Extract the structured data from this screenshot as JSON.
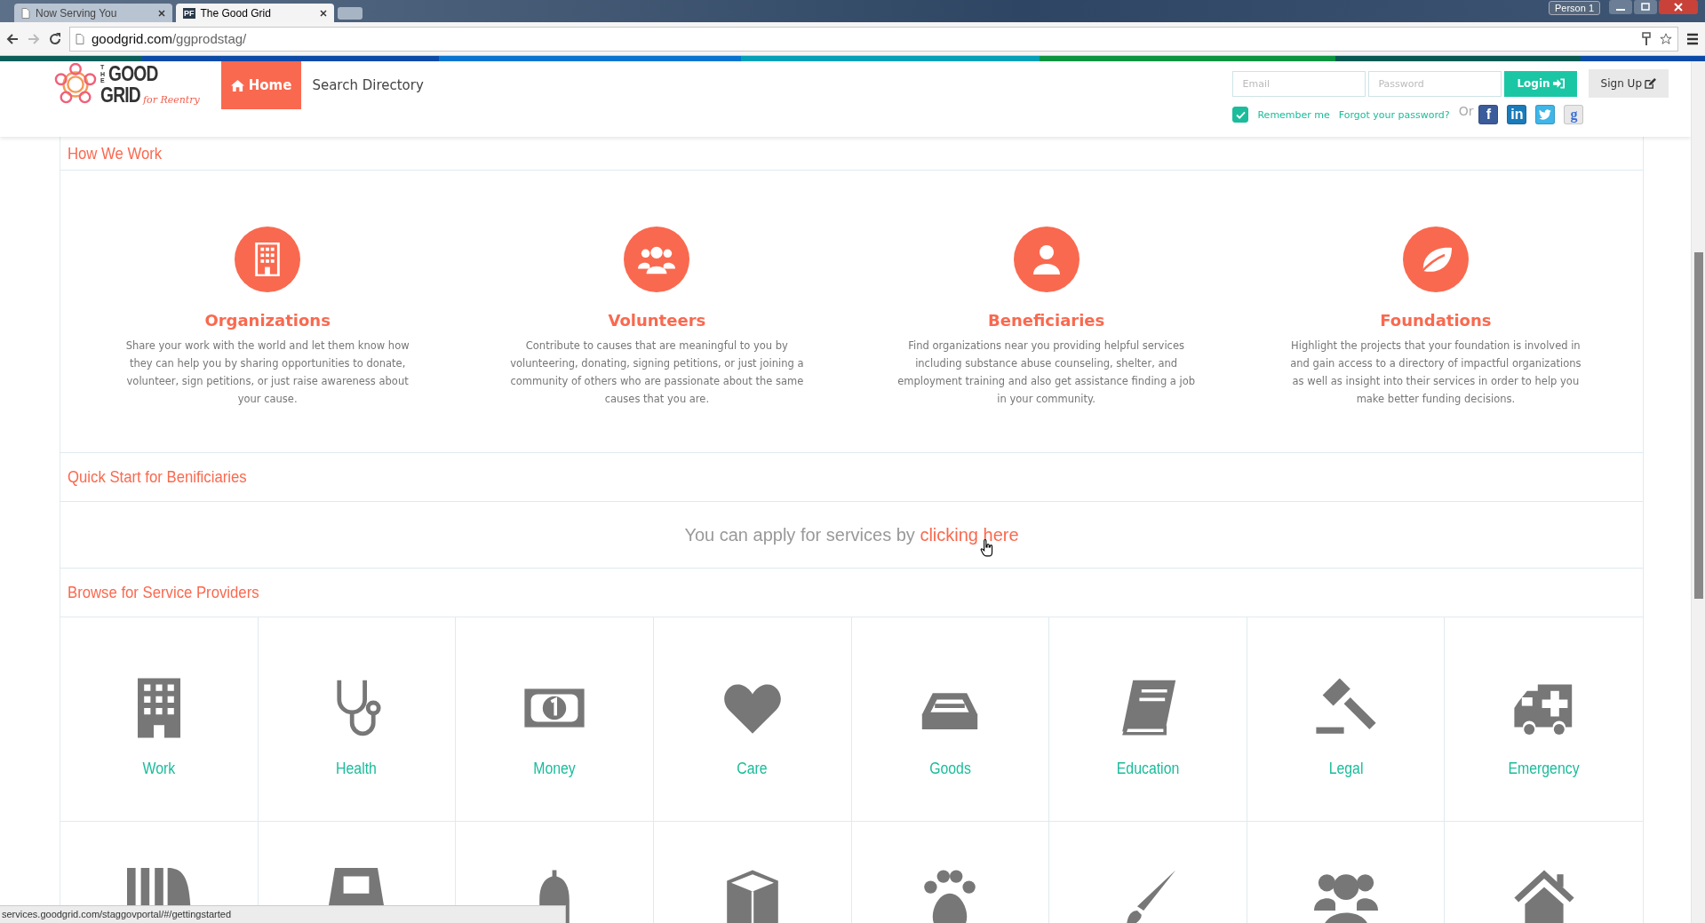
{
  "browser": {
    "tabs": [
      {
        "title": "Now Serving You",
        "selected": false
      },
      {
        "title": "The Good Grid",
        "favicon": "PF",
        "selected": true
      }
    ],
    "profile": "Person 1",
    "url_host": "goodgrid.com",
    "url_path": "/ggprodstag/"
  },
  "logo": {
    "the": "THE",
    "good": "GOOD",
    "grid": "GRID",
    "tagline": "for Reentry"
  },
  "nav": [
    {
      "label": "Home",
      "selected": true
    },
    {
      "label": "Search Directory",
      "selected": false
    }
  ],
  "login": {
    "email_placeholder": "Email",
    "password_placeholder": "Password",
    "login_button": "Login",
    "signup_button": "Sign Up",
    "remember_me": {
      "label": "Remember me",
      "checked": true
    },
    "forgot": "Forgot your password?",
    "or": "Or",
    "social": [
      {
        "kind": "facebook",
        "glyph": "f"
      },
      {
        "kind": "linkedin",
        "glyph": "in"
      },
      {
        "kind": "twitter"
      },
      {
        "kind": "google",
        "glyph": "g"
      }
    ]
  },
  "how_we_work": {
    "title": "How We Work",
    "cards": [
      {
        "kind": "building",
        "title": "Organizations",
        "text": "Share your work with the world and let them know how they can help you by sharing opportunities to donate, volunteer, sign petitions, or just raise awareness about your cause."
      },
      {
        "kind": "group",
        "title": "Volunteers",
        "text": "Contribute to causes that are meaningful to you by volunteering, donating, signing petitions, or just joining a community of others who are passionate about the same causes that you are."
      },
      {
        "kind": "person",
        "title": "Beneficiaries",
        "text": "Find organizations near you providing helpful services including substance abuse counseling, shelter, and employment training and also get assistance finding a job in your community."
      },
      {
        "kind": "leaf",
        "title": "Foundations",
        "text": "Highlight the projects that your foundation is involved in and gain access to a directory of impactful organizations as well as insight into their services in order to help you make better funding decisions."
      }
    ]
  },
  "quick_start": {
    "title": "Quick Start for Benificiaries",
    "text": "You can apply for services by",
    "link": "clicking here"
  },
  "browse": {
    "title": "Browse for Service Providers",
    "categories": [
      {
        "kind": "building",
        "label": "Work"
      },
      {
        "kind": "stethoscope",
        "label": "Health"
      },
      {
        "kind": "money",
        "label": "Money"
      },
      {
        "kind": "heart",
        "label": "Care"
      },
      {
        "kind": "tray",
        "label": "Goods"
      },
      {
        "kind": "book",
        "label": "Education"
      },
      {
        "kind": "gavel",
        "label": "Legal"
      },
      {
        "kind": "ambulance",
        "label": "Emergency"
      }
    ]
  },
  "status_bar": "services.goodgrid.com/staggovportal/#/gettingstarted"
}
